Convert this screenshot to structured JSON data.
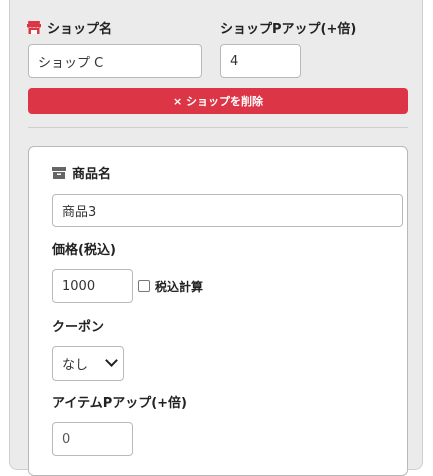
{
  "shop": {
    "name_label": "ショップ名",
    "name_value": "ショップ C",
    "point_label": "ショップPアップ(+倍)",
    "point_value": "4",
    "delete_label": "× ショップを削除",
    "icon": "store-icon",
    "accent_color": "#dc3545"
  },
  "item": {
    "name_label": "商品名",
    "name_value": "商品3",
    "icon": "box-icon",
    "price_label": "価格(税込)",
    "price_value": "1000",
    "tax_checkbox_label": "税込計算",
    "coupon_label": "クーポン",
    "coupon_value": "なし",
    "item_point_label": "アイテムPアップ(+倍)",
    "item_point_placeholder": "0"
  }
}
